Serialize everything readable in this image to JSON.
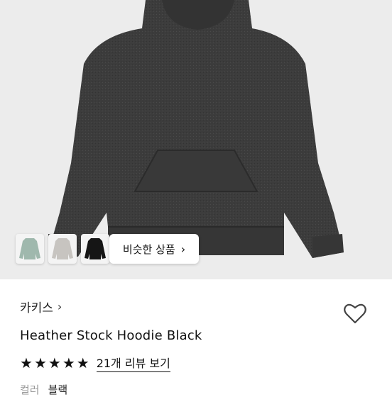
{
  "hero": {
    "icon": "black-hoodie-image"
  },
  "thumbnails": [
    {
      "name": "mint-hoodie-thumbnail",
      "color": "#9fb8ad"
    },
    {
      "name": "gray-hoodie-thumbnail",
      "color": "#c7c4c0"
    },
    {
      "name": "black-hoodie-thumbnail",
      "color": "#151515"
    }
  ],
  "similar": {
    "label": "비슷한 상품",
    "chevron": "›"
  },
  "product": {
    "brand": "카키스",
    "brand_chevron": "›",
    "title": "Heather Stock Hoodie Black",
    "stars": [
      "★",
      "★",
      "★",
      "★",
      "★"
    ],
    "reviews_label": "21개 리뷰 보기",
    "color_label": "컬러",
    "color_value": "블랙"
  },
  "colors": {
    "hero_bg": "#ececec",
    "hoodie": "#3b3b3b"
  }
}
